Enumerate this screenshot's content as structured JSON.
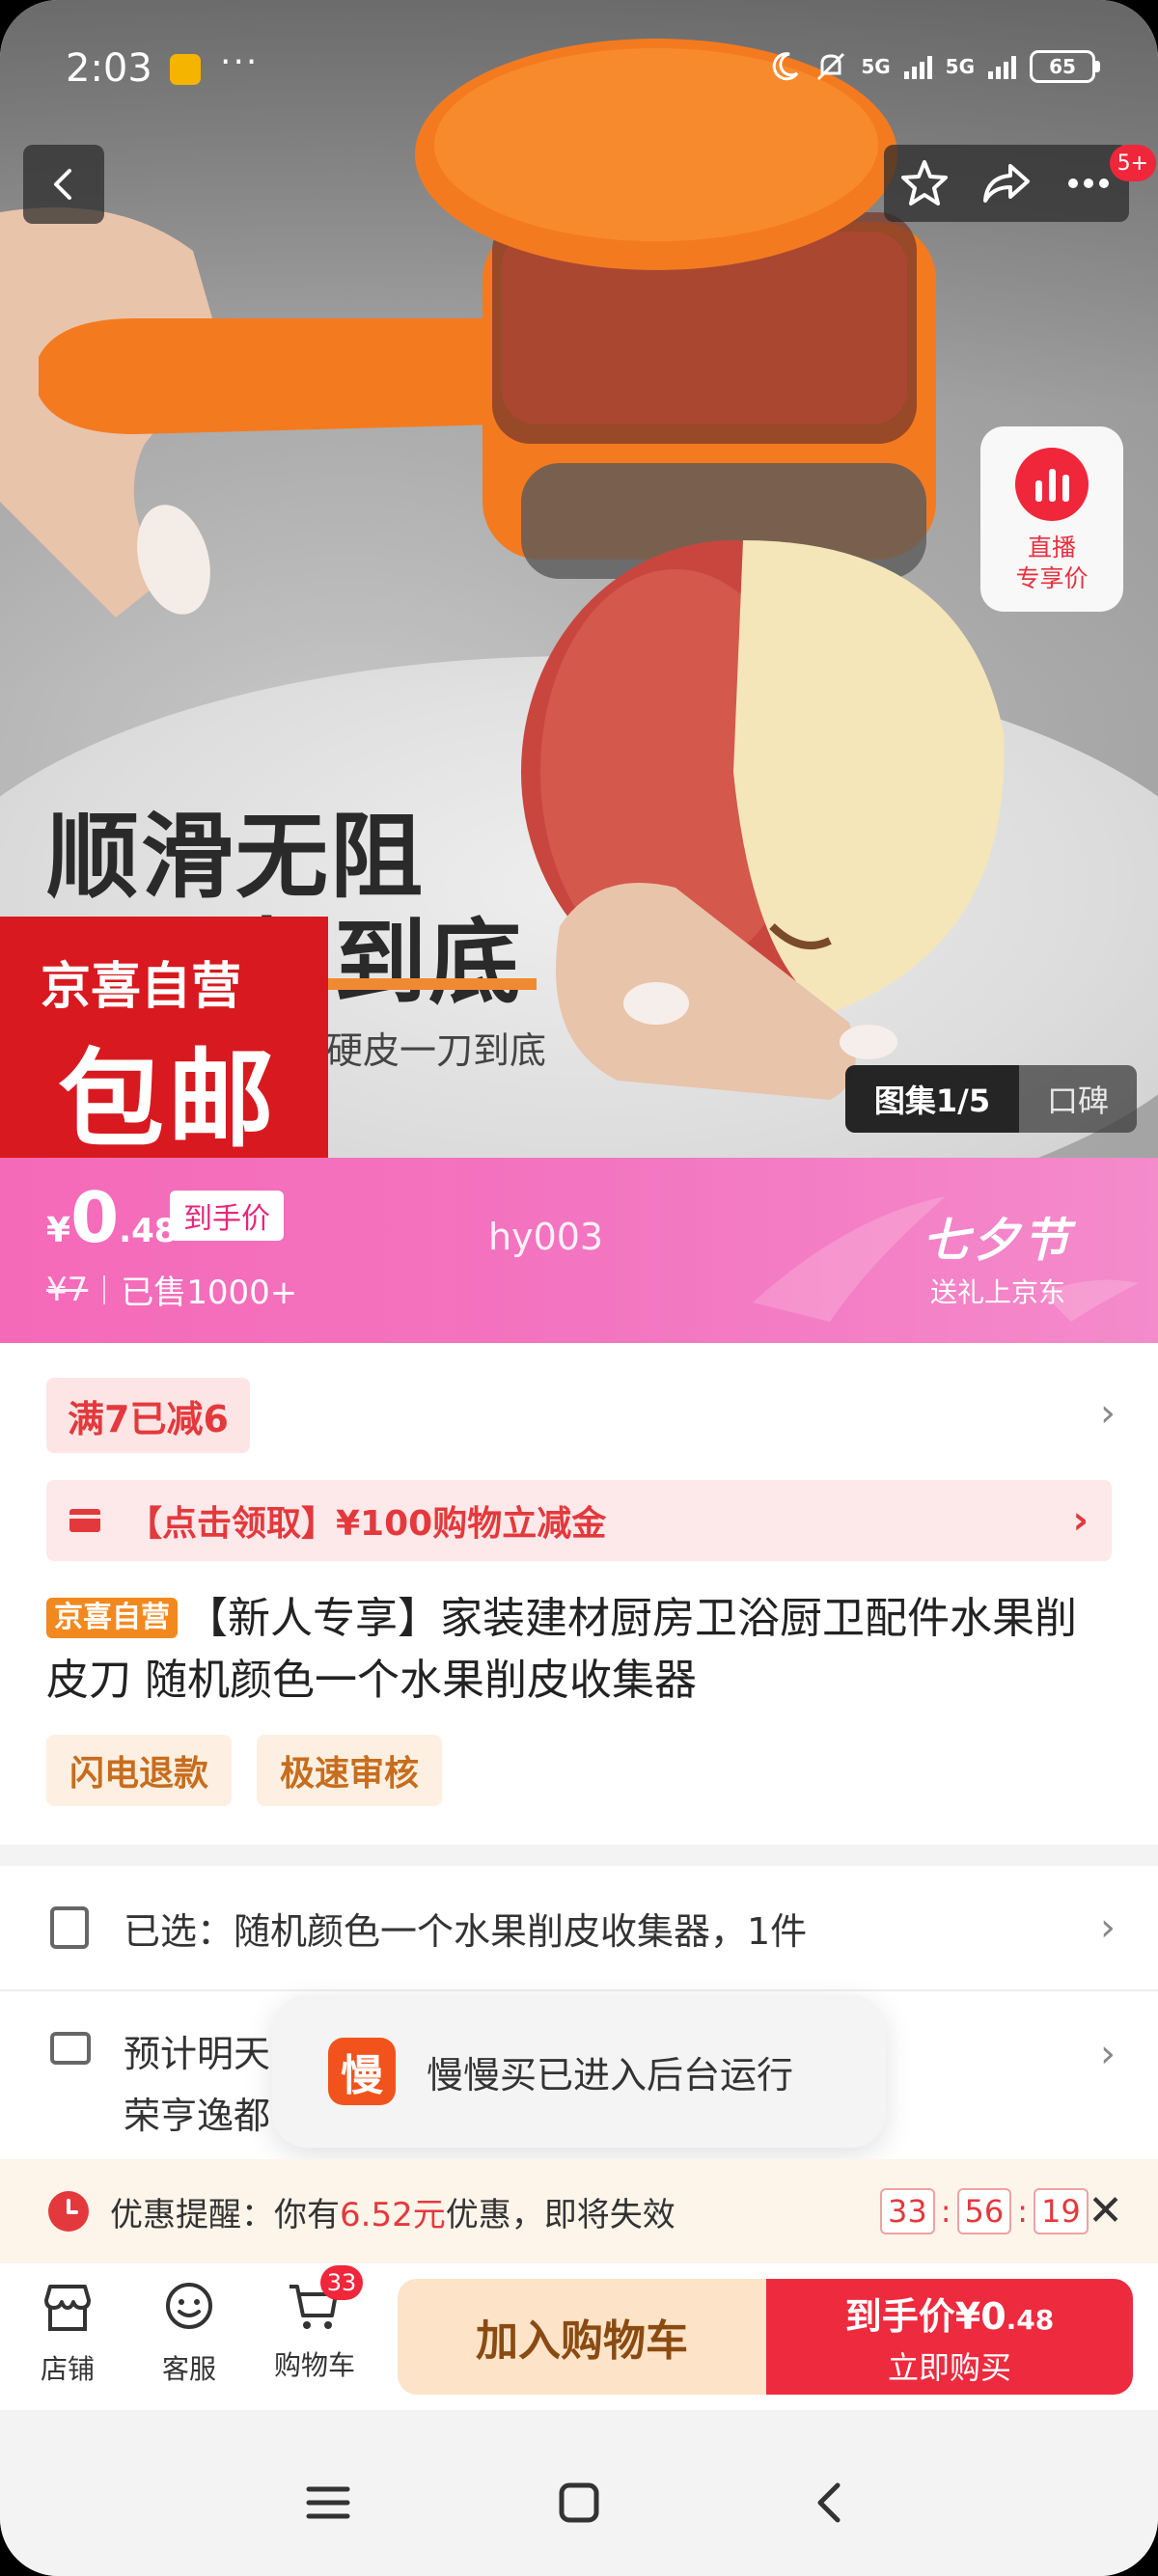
{
  "status_bar": {
    "time": "2:03",
    "more": "···",
    "network1": "5G",
    "network2": "5G",
    "battery": "65"
  },
  "hero": {
    "title_line1": "顺滑无阻",
    "title_line2": "削到底",
    "subtitle": "硬皮一刀到底",
    "promo_top": "京喜自营",
    "promo_big": "包邮",
    "live_label_1": "直播",
    "live_label_2": "专享价",
    "gallery_active": "图集1/5",
    "gallery_other": "口碑",
    "more_badge": "5+"
  },
  "price": {
    "currency": "¥",
    "int": "0",
    "decimal": ".48",
    "tag": "到手价",
    "old_price": "¥7",
    "sold": "已售1000+",
    "watermark": "hy003",
    "festival_name": "七夕节",
    "festival_sub": "送礼上京东"
  },
  "detail": {
    "coupon": "满7已减6",
    "claim": "【点击领取】¥100购物立减金",
    "badge": "京喜自营",
    "title": "【新人专享】家装建材厨房卫浴厨卫配件水果削皮刀 随机颜色一个水果削皮收集器",
    "tags": [
      "闪电退款",
      "极速审核"
    ]
  },
  "selection": {
    "selected": "已选：随机颜色一个水果削皮收集器，1件",
    "delivery_line1": "预计明天",
    "delivery_line2": "荣亨逸都"
  },
  "toast": {
    "icon_char": "慢",
    "text": "慢慢买已进入后台运行"
  },
  "reminder": {
    "prefix": "优惠提醒：你有",
    "amount": "6.52元",
    "suffix": "优惠，即将失效",
    "countdown": [
      "33",
      "56",
      "19"
    ],
    "close": "✕"
  },
  "bottom_bar": {
    "store": "店铺",
    "service": "客服",
    "cart": "购物车",
    "cart_count": "33",
    "add_to_cart": "加入购物车",
    "buy_label": "到手价¥0",
    "buy_decimal": ".48",
    "buy_now": "立即购买"
  },
  "colors": {
    "accent_red": "#e4393c",
    "pink_band": "#f374c0",
    "orange": "#f2891f"
  }
}
